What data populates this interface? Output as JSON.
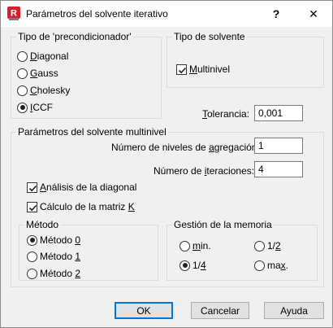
{
  "window": {
    "title": "Parámetros del solvente iterativo",
    "help": "?",
    "close": "✕",
    "icon_letter": "R"
  },
  "precond": {
    "legend": "Tipo de 'precondicionador'",
    "options": [
      {
        "pre": "",
        "key": "D",
        "post": "iagonal",
        "selected": false
      },
      {
        "pre": "",
        "key": "G",
        "post": "auss",
        "selected": false
      },
      {
        "pre": "",
        "key": "C",
        "post": "holesky",
        "selected": false
      },
      {
        "pre": "",
        "key": "I",
        "post": "CCF",
        "selected": true
      }
    ]
  },
  "solver_type": {
    "legend": "Tipo de solvente",
    "multinivel": {
      "pre": "",
      "key": "M",
      "post": "ultinivel",
      "checked": true
    }
  },
  "tolerancia": {
    "pre": "",
    "key": "T",
    "post": "olerancia:",
    "value": "0,001"
  },
  "multinivel_params": {
    "legend": "Parámetros del solvente multinivel",
    "niveles": {
      "pre": "Número de niveles de ",
      "key": "a",
      "post": "gregación:",
      "value": "1"
    },
    "iteraciones": {
      "pre": "Número de ",
      "key": "i",
      "post": "teraciones:",
      "value": "4"
    },
    "analisis": {
      "pre": "",
      "key": "A",
      "post": "nálisis de la diagonal",
      "checked": true
    },
    "calculo": {
      "pre": "Cálculo de la matriz ",
      "key": "K",
      "post": "",
      "checked": true
    }
  },
  "metodo": {
    "legend": "Método",
    "options": [
      {
        "pre": "Método ",
        "key": "0",
        "post": "",
        "selected": true
      },
      {
        "pre": "Método ",
        "key": "1",
        "post": "",
        "selected": false
      },
      {
        "pre": "Método ",
        "key": "2",
        "post": "",
        "selected": false
      }
    ]
  },
  "memoria": {
    "legend": "Gestión de la memoria",
    "options": [
      {
        "pre": "",
        "key": "m",
        "post": "in.",
        "selected": false
      },
      {
        "pre": "1/",
        "key": "2",
        "post": "",
        "selected": false
      },
      {
        "pre": "1/",
        "key": "4",
        "post": "",
        "selected": true
      },
      {
        "pre": "ma",
        "key": "x",
        "post": ".",
        "selected": false
      }
    ]
  },
  "buttons": {
    "ok": "OK",
    "cancel": "Cancelar",
    "help": "Ayuda"
  },
  "colors": {
    "accent": "#0078d7",
    "icon_red": "#d6202a"
  }
}
